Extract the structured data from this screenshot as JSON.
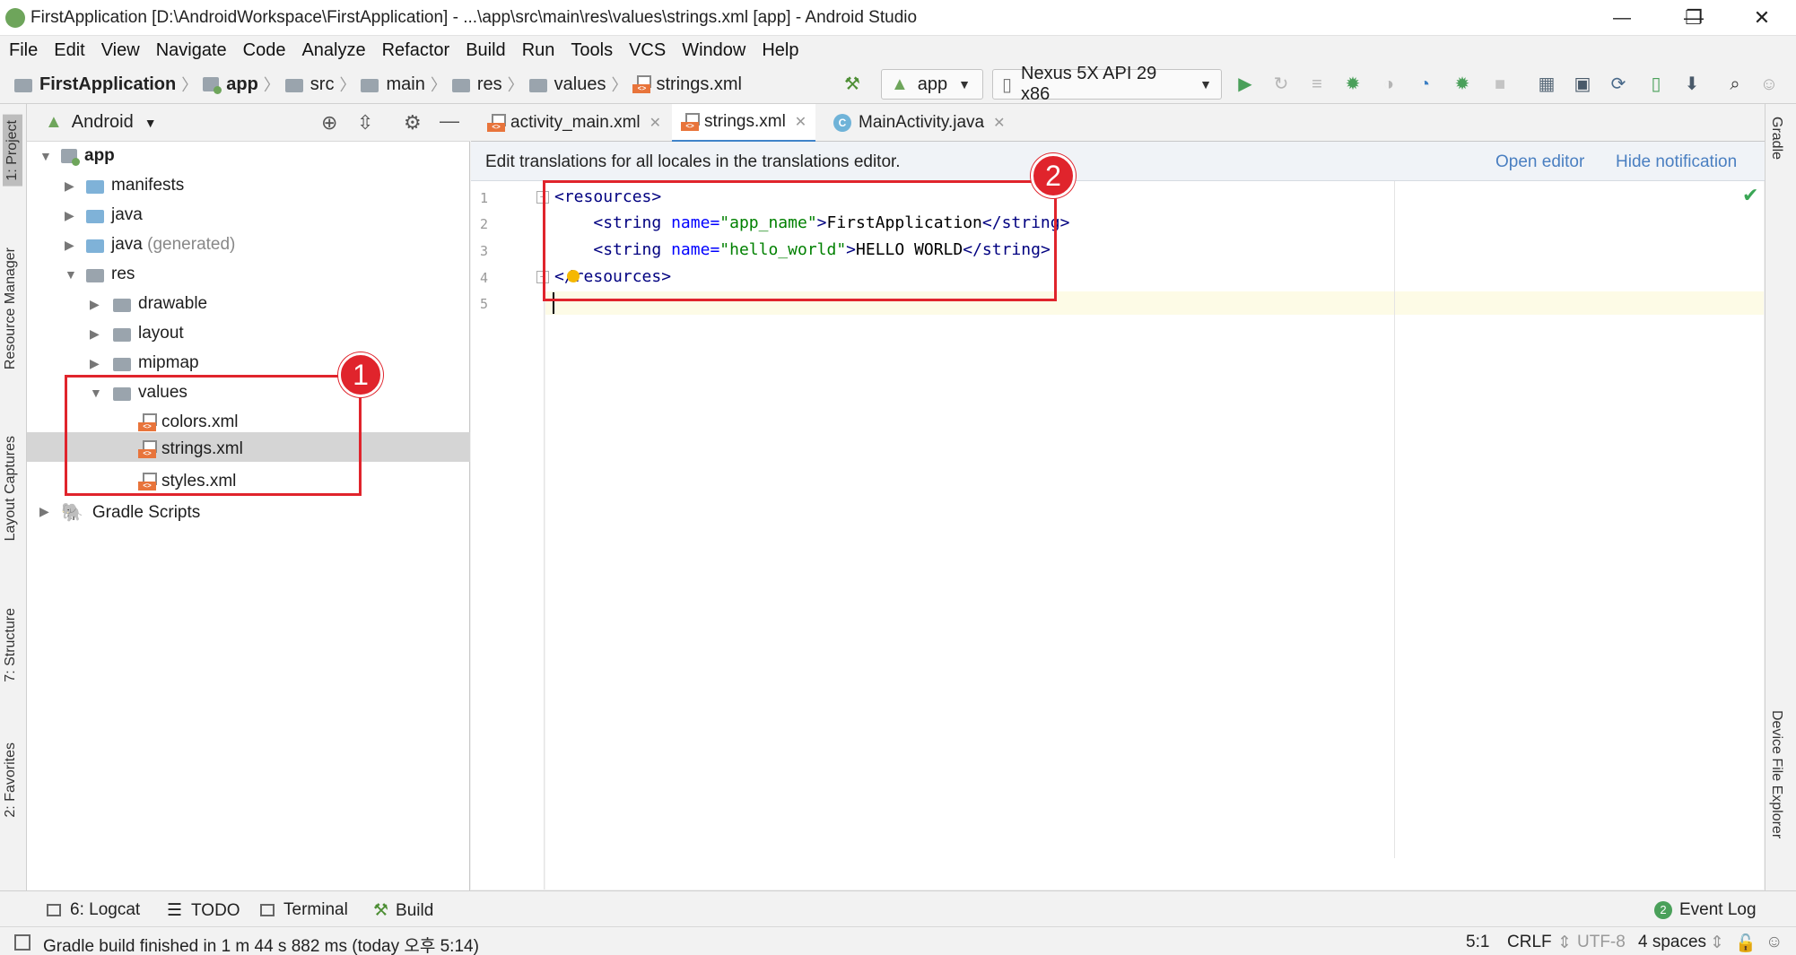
{
  "window": {
    "title": "FirstApplication [D:\\AndroidWorkspace\\FirstApplication] - ...\\app\\src\\main\\res\\values\\strings.xml [app] - Android Studio",
    "minimize": "—",
    "maximize": "❐",
    "close": "✕"
  },
  "menu": [
    "File",
    "Edit",
    "View",
    "Navigate",
    "Code",
    "Analyze",
    "Refactor",
    "Build",
    "Run",
    "Tools",
    "VCS",
    "Window",
    "Help"
  ],
  "breadcrumb": [
    "FirstApplication",
    "app",
    "src",
    "main",
    "res",
    "values",
    "strings.xml"
  ],
  "toolbar": {
    "config": "app",
    "device": "Nexus 5X API 29 x86"
  },
  "left_tabs": [
    "1: Project",
    "Resource Manager",
    "Layout Captures",
    "7: Structure",
    "2: Favorites"
  ],
  "right_tabs": [
    "Gradle",
    "Device File Explorer"
  ],
  "project": {
    "view": "Android",
    "tree": [
      {
        "label": "app",
        "bold": true
      },
      {
        "label": "manifests"
      },
      {
        "label": "java"
      },
      {
        "label": "java",
        "suffix": "(generated)"
      },
      {
        "label": "res"
      },
      {
        "label": "drawable"
      },
      {
        "label": "layout"
      },
      {
        "label": "mipmap"
      },
      {
        "label": "values"
      },
      {
        "label": "colors.xml"
      },
      {
        "label": "strings.xml"
      },
      {
        "label": "styles.xml"
      },
      {
        "label": "Gradle Scripts"
      }
    ]
  },
  "tabs": [
    {
      "label": "activity_main.xml"
    },
    {
      "label": "strings.xml",
      "active": true
    },
    {
      "label": "MainActivity.java"
    }
  ],
  "notification": {
    "message": "Edit translations for all locales in the translations editor.",
    "open": "Open editor",
    "hide": "Hide notification"
  },
  "editor": {
    "line_numbers": [
      "1",
      "2",
      "3",
      "4",
      "5"
    ],
    "lines": [
      {
        "indent": "",
        "open": "<",
        "tag": "resources",
        "close": ">"
      },
      {
        "indent": "    ",
        "tag": "string",
        "attr": "name",
        "value": "\"app_name\"",
        "text": "FirstApplication"
      },
      {
        "indent": "    ",
        "tag": "string",
        "attr": "name",
        "value": "\"hello_world\"",
        "text": "HELLO WORLD"
      },
      {
        "indent": "",
        "open": "</",
        "tag": "resources",
        "close": ">"
      }
    ]
  },
  "annotations": {
    "badge1": "1",
    "badge2": "2"
  },
  "bottom_tools": {
    "logcat": "6: Logcat",
    "todo": "TODO",
    "terminal": "Terminal",
    "build": "Build",
    "event_log": "Event Log",
    "event_count": "2"
  },
  "status": {
    "message": "Gradle build finished in 1 m 44 s 882 ms (today 오후 5:14)",
    "position": "5:1",
    "line_sep": "CRLF",
    "encoding": "UTF-8",
    "indent": "4 spaces"
  },
  "colors": {
    "accent_red": "#e0242c",
    "link_blue": "#4a7fc1",
    "tab_underline": "#4083c9"
  }
}
